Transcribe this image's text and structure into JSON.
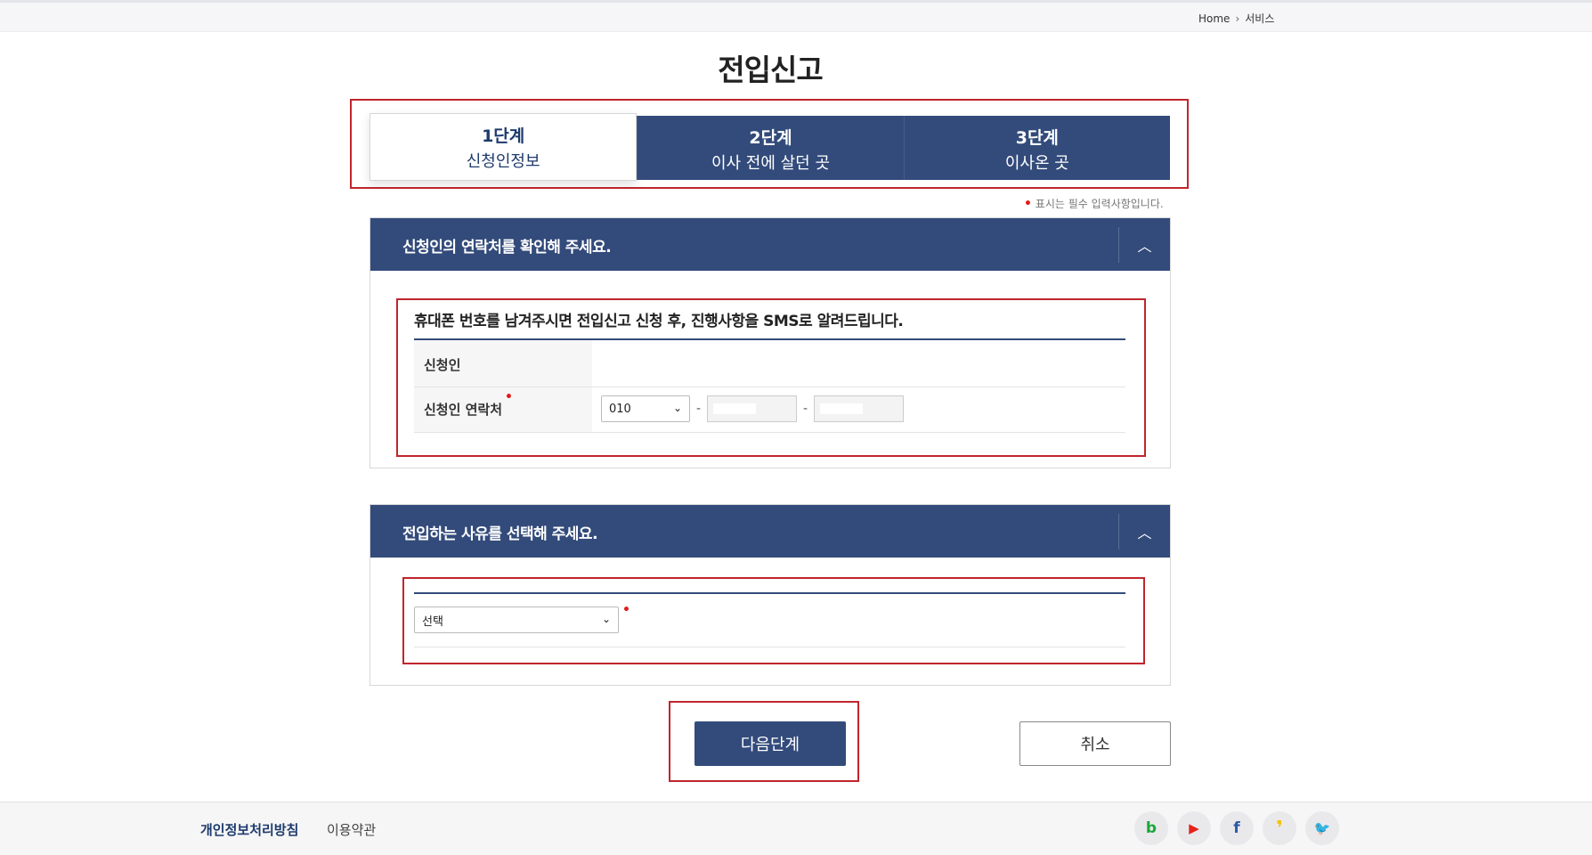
{
  "breadcrumb": {
    "home": "Home",
    "separator": "›",
    "current": "서비스"
  },
  "page": {
    "title": "전입신고"
  },
  "steps": [
    {
      "num": "1단계",
      "name": "신청인정보",
      "active": true
    },
    {
      "num": "2단계",
      "name": "이사 전에 살던 곳",
      "active": false
    },
    {
      "num": "3단계",
      "name": "이사온 곳",
      "active": false
    }
  ],
  "required_note": {
    "dot": "•",
    "text": "표시는 필수 입력사항입니다."
  },
  "section1": {
    "title": "신청인의 연락처를 확인해 주세요.",
    "toggle": "︿",
    "notice": "휴대폰 번호를 남겨주시면 전입신고 신청 후, 진행사항을 SMS로 알려드립니다.",
    "applicant_label": "신청인",
    "contact_label": "신청인 연락처",
    "required_dot": "•",
    "phone_prefix": "010",
    "dash": "-"
  },
  "section2": {
    "title": "전입하는 사유를 선택해 주세요.",
    "toggle": "︿",
    "reason_select": "선택",
    "required_dot": "•"
  },
  "buttons": {
    "next": "다음단계",
    "cancel": "취소"
  },
  "footer": {
    "privacy": "개인정보처리방침",
    "terms": "이용약관",
    "sns": [
      {
        "name": "blog",
        "glyph": "b",
        "color": "#19a83a"
      },
      {
        "name": "youtube",
        "glyph": "▶",
        "color": "#e62117"
      },
      {
        "name": "facebook",
        "glyph": "f",
        "color": "#2d5aa5"
      },
      {
        "name": "kakaostory",
        "glyph": "❜",
        "color": "#f2c200"
      },
      {
        "name": "twitter",
        "glyph": "🐦",
        "color": "#1da1f2"
      }
    ]
  },
  "colors": {
    "navy": "#334b7b",
    "highlight": "#c0252d",
    "required": "#e21b1b"
  }
}
